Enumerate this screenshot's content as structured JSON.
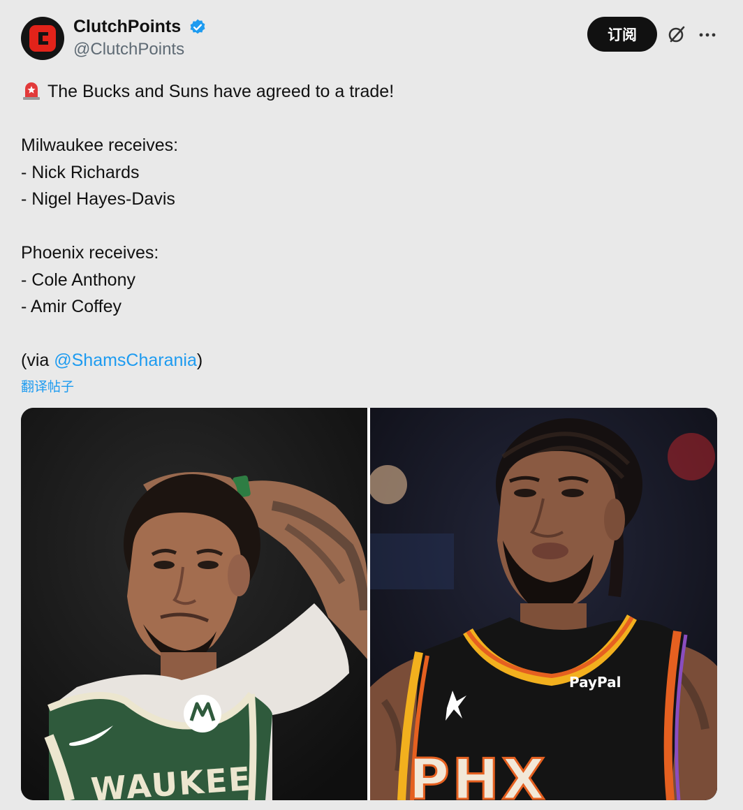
{
  "author": {
    "display_name": "ClutchPoints",
    "handle": "@ClutchPoints",
    "avatar_letter": "C",
    "verified": true
  },
  "actions": {
    "subscribe_label": "订阅",
    "grok_icon": "grok-slash-icon",
    "more_icon": "more-dots-icon"
  },
  "tweet": {
    "emoji": "siren-icon",
    "headline": "The Bucks and Suns have agreed to a trade!",
    "section1_title": "Milwaukee receives:",
    "section1_items": [
      "- Nick Richards",
      "- Nigel Hayes-Davis"
    ],
    "section2_title": "Phoenix receives:",
    "section2_items": [
      "- Cole Anthony",
      "- Amir Coffey"
    ],
    "via_prefix": "(via ",
    "via_mention": "@ShamsCharania",
    "via_suffix": ")",
    "translate_label": "翻译帖子"
  },
  "media": {
    "left_photo": {
      "jersey_text": "WAUKEE",
      "sponsor": "motorola-logo"
    },
    "right_photo": {
      "sponsor_text": "PayPal",
      "jersey_text": "PHX"
    }
  },
  "colors": {
    "accent": "#1d9bf0",
    "background": "#e9e9e9",
    "bucks_green": "#2f5a3c",
    "suns_orange": "#e56020"
  }
}
